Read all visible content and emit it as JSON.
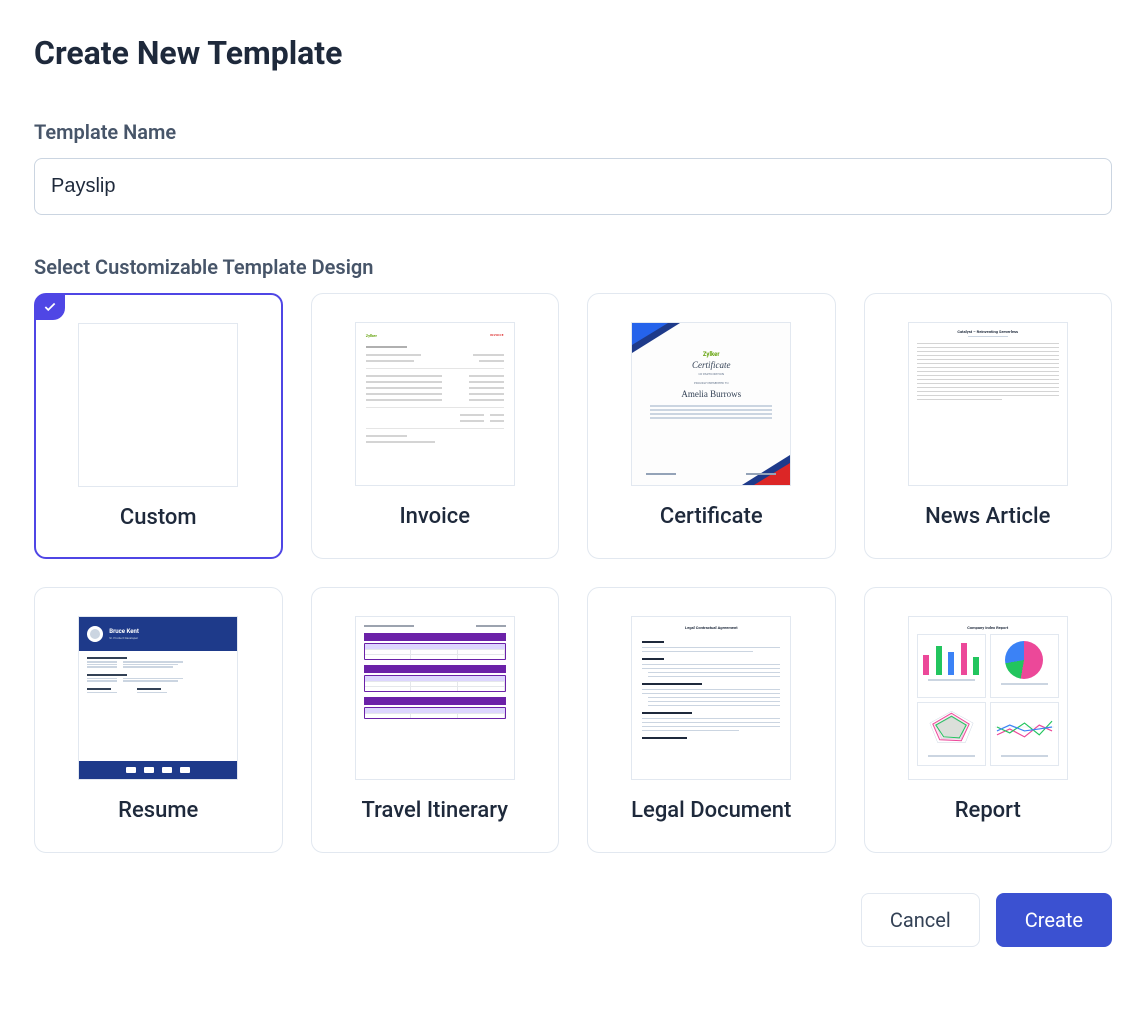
{
  "page_title": "Create New Template",
  "form": {
    "name_label": "Template Name",
    "name_value": "Payslip",
    "design_label": "Select Customizable Template Design"
  },
  "templates": [
    {
      "id": "custom",
      "label": "Custom",
      "selected": true
    },
    {
      "id": "invoice",
      "label": "Invoice",
      "selected": false
    },
    {
      "id": "certificate",
      "label": "Certificate",
      "selected": false
    },
    {
      "id": "news-article",
      "label": "News Article",
      "selected": false
    },
    {
      "id": "resume",
      "label": "Resume",
      "selected": false
    },
    {
      "id": "travel-itinerary",
      "label": "Travel Itinerary",
      "selected": false
    },
    {
      "id": "legal-document",
      "label": "Legal Document",
      "selected": false
    },
    {
      "id": "report",
      "label": "Report",
      "selected": false
    }
  ],
  "actions": {
    "cancel": "Cancel",
    "create": "Create"
  },
  "thumbnails": {
    "invoice_logo": "Zylker",
    "invoice_badge": "INVOICE",
    "certificate_logo": "Zylker",
    "certificate_title": "Certificate",
    "certificate_sub": "OF PARTICIPATION",
    "certificate_presented": "PROUDLY PRESENTED TO",
    "certificate_name": "Amelia Burrows",
    "news_title": "Catalyst – Reinventing Serverless",
    "resume_name": "Bruce Kent",
    "resume_role": "Sr. Product Developer",
    "legal_title": "Legal Contractual Agreement",
    "report_title": "Company Index Report"
  }
}
